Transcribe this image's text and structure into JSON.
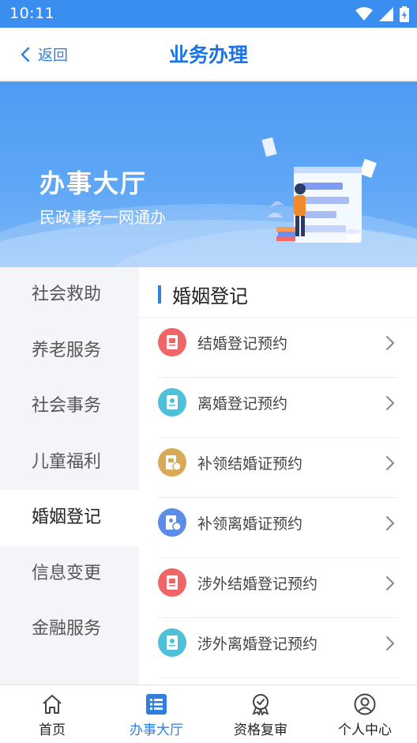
{
  "status_bar": {
    "time": "10:11"
  },
  "nav": {
    "back_label": "返回",
    "title": "业务办理"
  },
  "banner": {
    "title": "办事大厅",
    "subtitle": "民政事务一网通办"
  },
  "left_menu": {
    "active_index": 4,
    "items": [
      {
        "label": "社会救助"
      },
      {
        "label": "养老服务"
      },
      {
        "label": "社会事务"
      },
      {
        "label": "儿童福利"
      },
      {
        "label": "婚姻登记"
      },
      {
        "label": "信息变更"
      },
      {
        "label": "金融服务"
      }
    ]
  },
  "section": {
    "title": "婚姻登记",
    "services": [
      {
        "label": "结婚登记预约",
        "icon": "marriage-certificate-icon",
        "color": "#f06666"
      },
      {
        "label": "离婚登记预约",
        "icon": "divorce-certificate-icon",
        "color": "#4fc0d9"
      },
      {
        "label": "补领结婚证预约",
        "icon": "reissue-marriage-icon",
        "color": "#d9a956"
      },
      {
        "label": "补领离婚证预约",
        "icon": "reissue-divorce-icon",
        "color": "#5b8de8"
      },
      {
        "label": "涉外结婚登记预约",
        "icon": "foreign-marriage-icon",
        "color": "#f06666"
      },
      {
        "label": "涉外离婚登记预约",
        "icon": "foreign-divorce-icon",
        "color": "#4fc0d9"
      }
    ]
  },
  "tabbar": {
    "active_index": 1,
    "tabs": [
      {
        "label": "首页",
        "icon": "home-icon"
      },
      {
        "label": "办事大厅",
        "icon": "list-icon"
      },
      {
        "label": "资格复审",
        "icon": "badge-icon"
      },
      {
        "label": "个人中心",
        "icon": "user-icon"
      }
    ]
  },
  "colors": {
    "accent": "#2e7fe0",
    "status_bar": "#3a8ef0",
    "menu_bg": "#f3f5f8"
  }
}
